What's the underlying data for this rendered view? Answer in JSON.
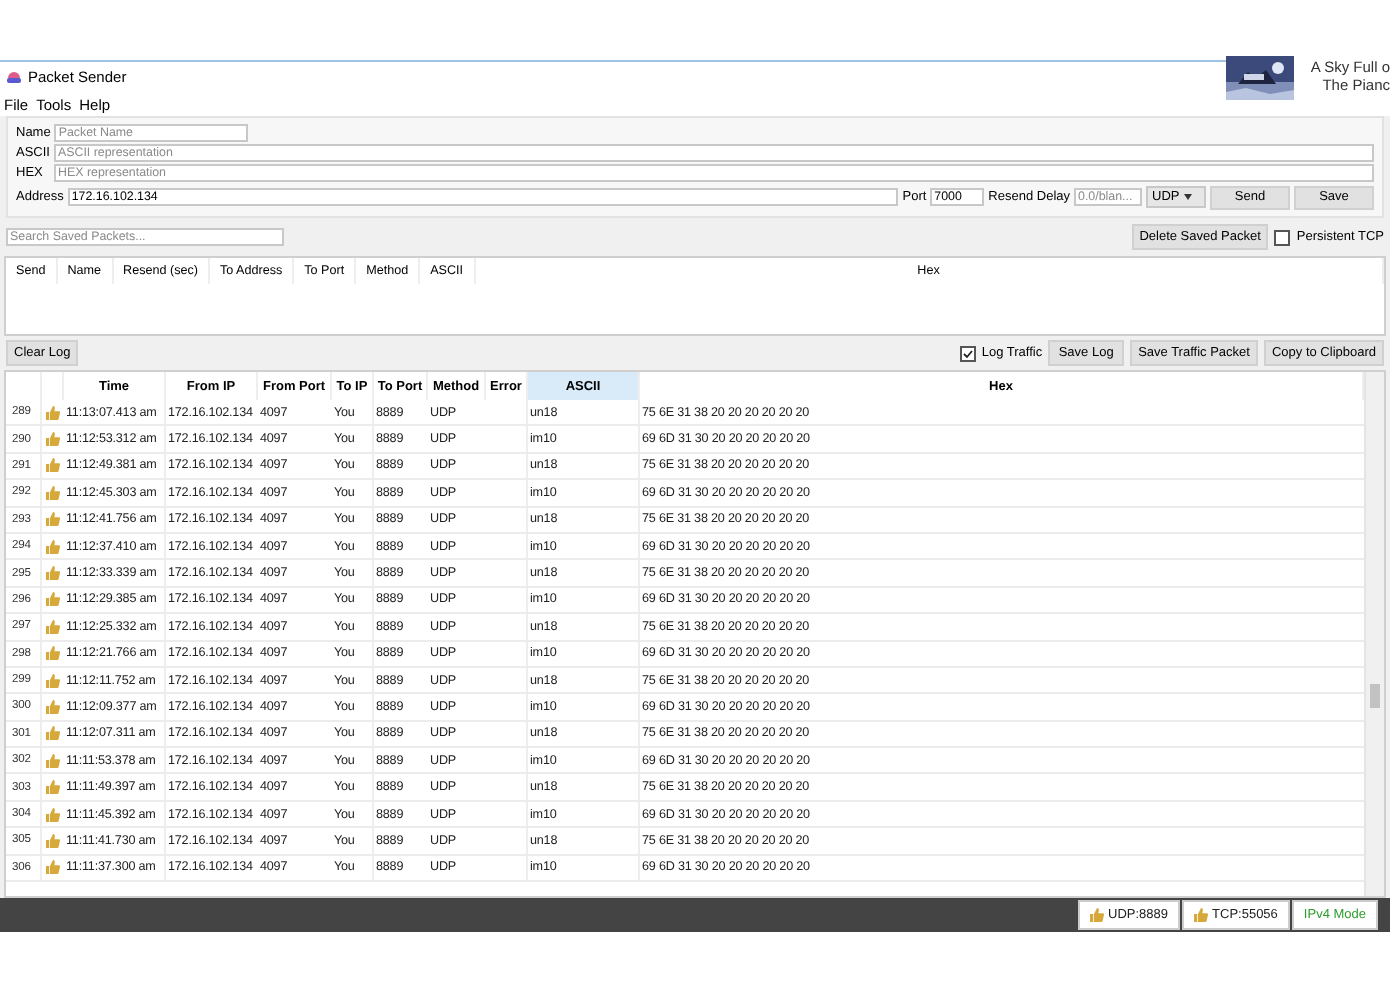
{
  "window": {
    "title": "Packet Sender"
  },
  "media_popup": {
    "title": "A Sky Full o",
    "artist": "The Pianc"
  },
  "menu": [
    "File",
    "Tools",
    "Help"
  ],
  "packet_form": {
    "name": {
      "label": "Name",
      "placeholder": "Packet Name"
    },
    "ascii": {
      "label": "ASCII",
      "placeholder": "ASCII representation"
    },
    "hex": {
      "label": "HEX",
      "placeholder": "HEX representation"
    },
    "address": {
      "label": "Address",
      "value": "172.16.102.134"
    },
    "port": {
      "label": "Port",
      "value": "7000"
    },
    "resend_delay": {
      "label": "Resend Delay",
      "placeholder": "0.0/blan..."
    },
    "method": {
      "value": "UDP"
    },
    "buttons": [
      "Send",
      "Save"
    ]
  },
  "saved": {
    "search": {
      "placeholder": "Search Saved Packets..."
    },
    "delete_button": "Delete Saved Packet",
    "persistent_tcp": {
      "label": "Persistent TCP",
      "checked": false
    },
    "columns": [
      "Send",
      "Name",
      "Resend (sec)",
      "To Address",
      "To Port",
      "Method",
      "ASCII",
      "Hex"
    ]
  },
  "log": {
    "clear_button": "Clear Log",
    "log_traffic": {
      "label": "Log Traffic",
      "checked": true
    },
    "buttons": [
      "Save Log",
      "Save Traffic Packet",
      "Copy to Clipboard"
    ],
    "columns": [
      {
        "label": "Time",
        "selected": false
      },
      {
        "label": "From IP",
        "selected": false
      },
      {
        "label": "From Port",
        "selected": false
      },
      {
        "label": "To IP",
        "selected": false
      },
      {
        "label": "To Port",
        "selected": false
      },
      {
        "label": "Method",
        "selected": false
      },
      {
        "label": "Error",
        "selected": false
      },
      {
        "label": "ASCII",
        "selected": true
      },
      {
        "label": "Hex",
        "selected": false
      }
    ],
    "rows": [
      {
        "number": "289",
        "time": "11:13:07.413 am",
        "from_ip": "172.16.102.134",
        "from_port": "4097",
        "to_ip": "You",
        "to_port": "8889",
        "method": "UDP",
        "ascii": "un18",
        "hex": "75 6E 31 38 20 20 20 20 20 20"
      },
      {
        "number": "290",
        "time": "11:12:53.312 am",
        "from_ip": "172.16.102.134",
        "from_port": "4097",
        "to_ip": "You",
        "to_port": "8889",
        "method": "UDP",
        "ascii": "im10",
        "hex": "69 6D 31 30 20 20 20 20 20 20"
      },
      {
        "number": "291",
        "time": "11:12:49.381 am",
        "from_ip": "172.16.102.134",
        "from_port": "4097",
        "to_ip": "You",
        "to_port": "8889",
        "method": "UDP",
        "ascii": "un18",
        "hex": "75 6E 31 38 20 20 20 20 20 20"
      },
      {
        "number": "292",
        "time": "11:12:45.303 am",
        "from_ip": "172.16.102.134",
        "from_port": "4097",
        "to_ip": "You",
        "to_port": "8889",
        "method": "UDP",
        "ascii": "im10",
        "hex": "69 6D 31 30 20 20 20 20 20 20"
      },
      {
        "number": "293",
        "time": "11:12:41.756 am",
        "from_ip": "172.16.102.134",
        "from_port": "4097",
        "to_ip": "You",
        "to_port": "8889",
        "method": "UDP",
        "ascii": "un18",
        "hex": "75 6E 31 38 20 20 20 20 20 20"
      },
      {
        "number": "294",
        "time": "11:12:37.410 am",
        "from_ip": "172.16.102.134",
        "from_port": "4097",
        "to_ip": "You",
        "to_port": "8889",
        "method": "UDP",
        "ascii": "im10",
        "hex": "69 6D 31 30 20 20 20 20 20 20"
      },
      {
        "number": "295",
        "time": "11:12:33.339 am",
        "from_ip": "172.16.102.134",
        "from_port": "4097",
        "to_ip": "You",
        "to_port": "8889",
        "method": "UDP",
        "ascii": "un18",
        "hex": "75 6E 31 38 20 20 20 20 20 20"
      },
      {
        "number": "296",
        "time": "11:12:29.385 am",
        "from_ip": "172.16.102.134",
        "from_port": "4097",
        "to_ip": "You",
        "to_port": "8889",
        "method": "UDP",
        "ascii": "im10",
        "hex": "69 6D 31 30 20 20 20 20 20 20"
      },
      {
        "number": "297",
        "time": "11:12:25.332 am",
        "from_ip": "172.16.102.134",
        "from_port": "4097",
        "to_ip": "You",
        "to_port": "8889",
        "method": "UDP",
        "ascii": "un18",
        "hex": "75 6E 31 38 20 20 20 20 20 20"
      },
      {
        "number": "298",
        "time": "11:12:21.766 am",
        "from_ip": "172.16.102.134",
        "from_port": "4097",
        "to_ip": "You",
        "to_port": "8889",
        "method": "UDP",
        "ascii": "im10",
        "hex": "69 6D 31 30 20 20 20 20 20 20"
      },
      {
        "number": "299",
        "time": "11:12:11.752 am",
        "from_ip": "172.16.102.134",
        "from_port": "4097",
        "to_ip": "You",
        "to_port": "8889",
        "method": "UDP",
        "ascii": "un18",
        "hex": "75 6E 31 38 20 20 20 20 20 20"
      },
      {
        "number": "300",
        "time": "11:12:09.377 am",
        "from_ip": "172.16.102.134",
        "from_port": "4097",
        "to_ip": "You",
        "to_port": "8889",
        "method": "UDP",
        "ascii": "im10",
        "hex": "69 6D 31 30 20 20 20 20 20 20"
      },
      {
        "number": "301",
        "time": "11:12:07.311 am",
        "from_ip": "172.16.102.134",
        "from_port": "4097",
        "to_ip": "You",
        "to_port": "8889",
        "method": "UDP",
        "ascii": "un18",
        "hex": "75 6E 31 38 20 20 20 20 20 20"
      },
      {
        "number": "302",
        "time": "11:11:53.378 am",
        "from_ip": "172.16.102.134",
        "from_port": "4097",
        "to_ip": "You",
        "to_port": "8889",
        "method": "UDP",
        "ascii": "im10",
        "hex": "69 6D 31 30 20 20 20 20 20 20"
      },
      {
        "number": "303",
        "time": "11:11:49.397 am",
        "from_ip": "172.16.102.134",
        "from_port": "4097",
        "to_ip": "You",
        "to_port": "8889",
        "method": "UDP",
        "ascii": "un18",
        "hex": "75 6E 31 38 20 20 20 20 20 20"
      },
      {
        "number": "304",
        "time": "11:11:45.392 am",
        "from_ip": "172.16.102.134",
        "from_port": "4097",
        "to_ip": "You",
        "to_port": "8889",
        "method": "UDP",
        "ascii": "im10",
        "hex": "69 6D 31 30 20 20 20 20 20 20"
      },
      {
        "number": "305",
        "time": "11:11:41.730 am",
        "from_ip": "172.16.102.134",
        "from_port": "4097",
        "to_ip": "You",
        "to_port": "8889",
        "method": "UDP",
        "ascii": "un18",
        "hex": "75 6E 31 38 20 20 20 20 20 20"
      },
      {
        "number": "306",
        "time": "11:11:37.300 am",
        "from_ip": "172.16.102.134",
        "from_port": "4097",
        "to_ip": "You",
        "to_port": "8889",
        "method": "UDP",
        "ascii": "im10",
        "hex": "69 6D 31 30 20 20 20 20 20 20"
      }
    ]
  },
  "status_bar": [
    {
      "kind": "port",
      "text": "UDP:8889"
    },
    {
      "kind": "port",
      "text": "TCP:55056"
    },
    {
      "kind": "mode",
      "text": "IPv4 Mode"
    }
  ]
}
